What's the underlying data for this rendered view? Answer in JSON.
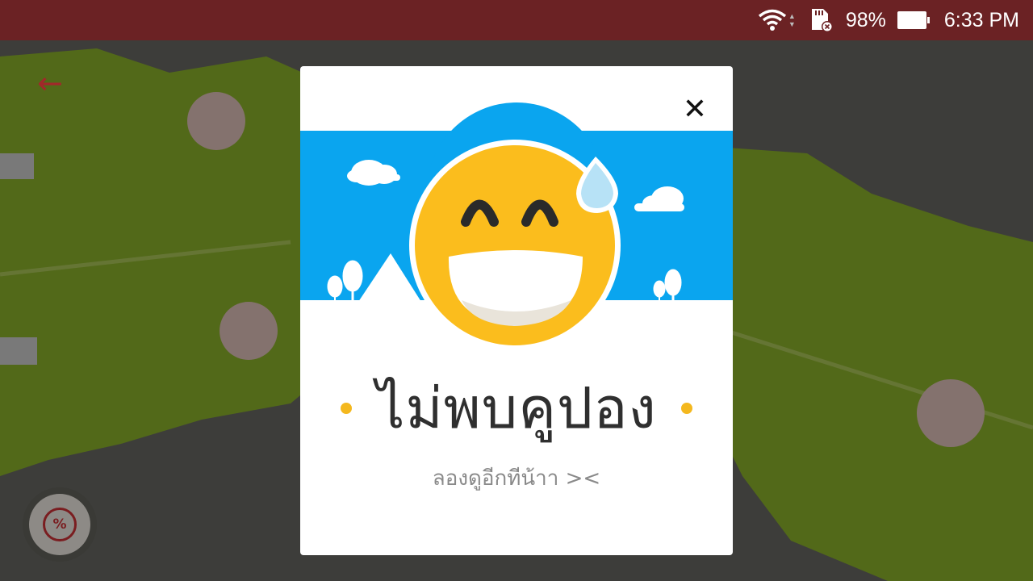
{
  "status_bar": {
    "battery_percent": "98%",
    "time": "6:33 PM",
    "icons": [
      "wifi-icon",
      "sd-card-missing-icon",
      "battery-icon"
    ]
  },
  "app": {
    "back_icon": "back-arrow-icon",
    "coupon_icon": "coupon-badge-icon",
    "coupon_symbol": "%"
  },
  "dialog": {
    "title": "ไม่พบคูปอง",
    "subtitle": "ลองดูอีกทีน้าา ><",
    "close_symbol": "✕"
  },
  "colors": {
    "status_bar": "#6b2224",
    "accent_red": "#a2282a",
    "sky_blue": "#0aa5ef",
    "emoji_yellow": "#fbbd1d",
    "dot_yellow": "#f4b81e"
  }
}
